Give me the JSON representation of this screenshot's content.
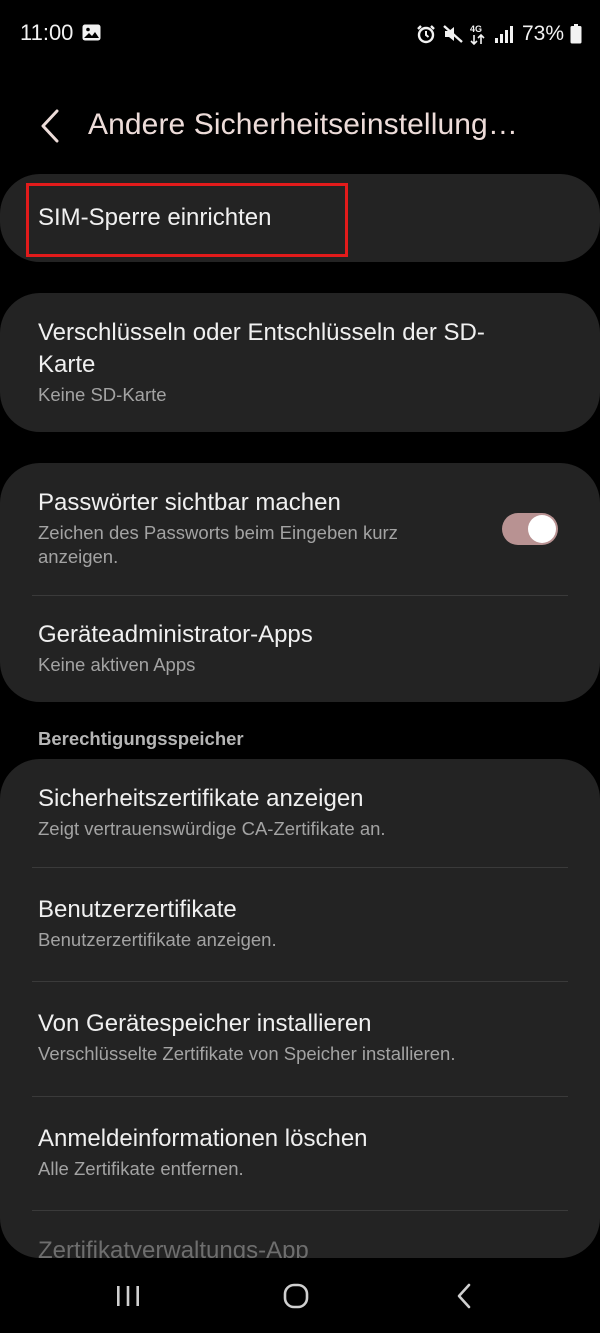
{
  "status_bar": {
    "time": "11:00",
    "battery_percent": "73%",
    "network_label": "4G",
    "icons": [
      "image-icon",
      "alarm-icon",
      "mute-icon",
      "4g-data-icon",
      "signal-icon",
      "battery-icon"
    ]
  },
  "header": {
    "title": "Andere Sicherheitseinstellung…",
    "back_icon": "chevron-left-icon"
  },
  "items": {
    "sim_lock": {
      "title": "SIM-Sperre einrichten"
    },
    "sd_encrypt": {
      "title": "Verschlüsseln oder Entschlüsseln der SD-Karte",
      "subtitle": "Keine SD-Karte"
    },
    "show_passwords": {
      "title": "Passwörter sichtbar machen",
      "subtitle": "Zeichen des Passworts beim Eingeben kurz anzeigen.",
      "enabled": true
    },
    "device_admin": {
      "title": "Geräteadministrator-Apps",
      "subtitle": "Keine aktiven Apps"
    }
  },
  "credential_storage": {
    "label": "Berechtigungsspeicher",
    "items": [
      {
        "title": "Sicherheitszertifikate anzeigen",
        "subtitle": "Zeigt vertrauenswürdige CA-Zertifikate an."
      },
      {
        "title": "Benutzerzertifikate",
        "subtitle": "Benutzerzertifikate anzeigen."
      },
      {
        "title": "Von Gerätespeicher installieren",
        "subtitle": "Verschlüsselte Zertifikate von Speicher installieren."
      },
      {
        "title": "Anmeldeinformationen löschen",
        "subtitle": "Alle Zertifikate entfernen."
      },
      {
        "title": "Zertifikatverwaltungs-App"
      }
    ]
  },
  "navigation": {
    "recent_icon": "recent-apps-icon",
    "home_icon": "home-icon",
    "back_icon": "back-icon"
  },
  "colors": {
    "background": "#000000",
    "card": "#232323",
    "title_tint": "#eddcd9",
    "highlight": "#e21b1b",
    "toggle_track": "#b89292"
  }
}
